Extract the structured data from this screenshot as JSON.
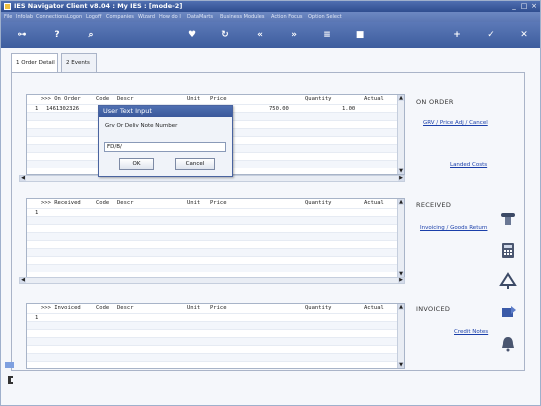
{
  "window": {
    "title": "IES Navigator Client v8.04 : My IES :       [mode-2]",
    "controls": [
      "_",
      "□",
      "×"
    ]
  },
  "menu": [
    "File",
    "Infolab",
    "Connections",
    "Logon",
    "Logoff",
    "Companies",
    "Wizard",
    "How do I",
    "DataMarts",
    "Business Modules",
    "Action Focus",
    "Option Select"
  ],
  "toolbar_icons": [
    "key-icon",
    "help-icon",
    "search-icon",
    "heart-icon",
    "refresh-icon",
    "back-icon",
    "forward-icon",
    "list-icon",
    "stop-icon",
    "add-icon",
    "check-icon",
    "close-icon"
  ],
  "tabs": [
    {
      "label": "1 Order Detail"
    },
    {
      "label": "2 Events"
    }
  ],
  "on_order_grid": {
    "headers": [
      ">>> On Order",
      "Code",
      "Descr",
      "Unit",
      "Price",
      "Quantity",
      "Actual"
    ],
    "rows": [
      {
        "num": "1",
        "order": "1461302326",
        "price": "750.00",
        "quantity": "1.00"
      }
    ]
  },
  "received_grid": {
    "headers": [
      ">>> Received",
      "Code",
      "Descr",
      "Unit",
      "Price",
      "Quantity",
      "Actual"
    ],
    "rows": [
      {
        "num": "1"
      }
    ]
  },
  "invoiced_grid": {
    "headers": [
      ">>> Invoiced",
      "Code",
      "Descr",
      "Unit",
      "Price",
      "Quantity",
      "Actual"
    ],
    "rows": [
      {
        "num": "1"
      }
    ]
  },
  "side_panel": {
    "on_order": {
      "title": "ON ORDER",
      "link1": "GRV / Price Adj / Cancel",
      "link2": "Landed Costs"
    },
    "received": {
      "title": "RECEIVED",
      "link": "Invoicing / Goods Return"
    },
    "invoiced": {
      "title": "INVOICED",
      "link": "Credit Notes"
    }
  },
  "dialog": {
    "title": "User Text Input",
    "label": "Grv Or Deliv Note Number",
    "value": "FD/B/",
    "ok": "OK",
    "cancel": "Cancel"
  },
  "colors": {
    "titlebar": "#3a589b",
    "link": "#1a3faa",
    "accent": "#4f6fb1"
  }
}
